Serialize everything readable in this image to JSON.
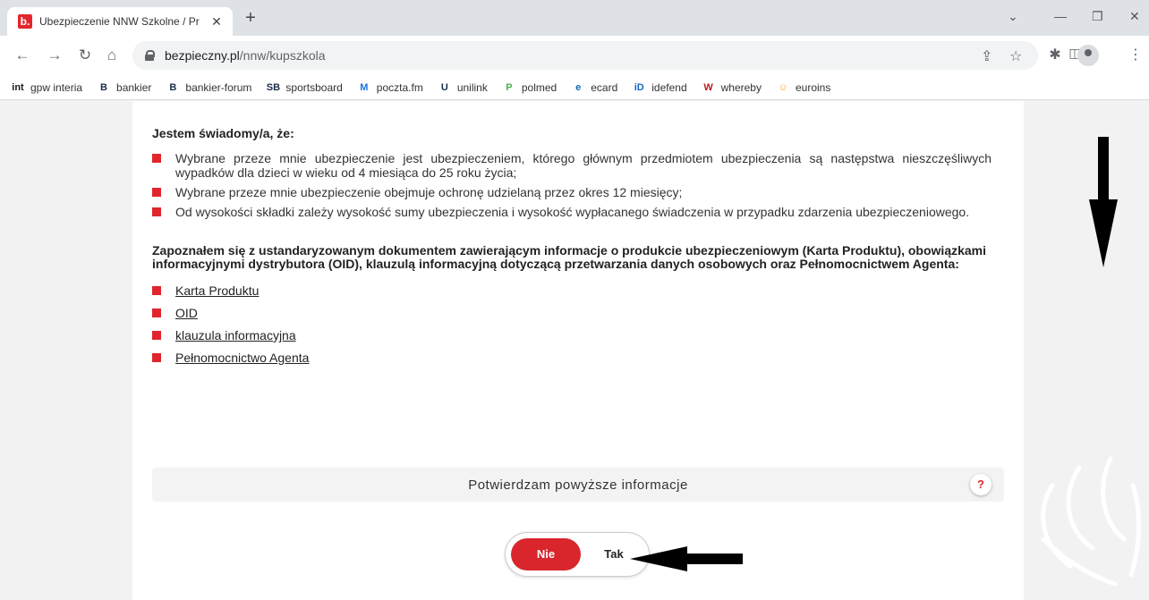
{
  "browser": {
    "tab_title": "Ubezpieczenie NNW Szkolne / Pr",
    "tab_favicon_letter": "b.",
    "new_tab_symbol": "+",
    "close_symbol": "✕",
    "url_host": "bezpieczny.pl",
    "url_path": "/nnw/kupszkola",
    "bookmarks": [
      {
        "label": "gpw interia",
        "icon": "int",
        "color": "#1a1a1a"
      },
      {
        "label": "bankier",
        "icon": "B",
        "color": "#1b2a4a"
      },
      {
        "label": "bankier-forum",
        "icon": "B",
        "color": "#1b2a4a"
      },
      {
        "label": "sportsboard",
        "icon": "SB",
        "color": "#1b2a4a"
      },
      {
        "label": "poczta.fm",
        "icon": "M",
        "color": "#1a73e8"
      },
      {
        "label": "unilink",
        "icon": "U",
        "color": "#1b2a4a"
      },
      {
        "label": "polmed",
        "icon": "P",
        "color": "#4caf50"
      },
      {
        "label": "ecard",
        "icon": "e",
        "color": "#1565c0"
      },
      {
        "label": "idefend",
        "icon": "iD",
        "color": "#1565c0"
      },
      {
        "label": "whereby",
        "icon": "W",
        "color": "#b71c1c"
      },
      {
        "label": "euroins",
        "icon": "☺",
        "color": "#f9a825"
      }
    ]
  },
  "page": {
    "heading": "Jestem świadomy/a, że:",
    "statements": [
      "Wybrane przeze mnie ubezpieczenie jest ubezpieczeniem, którego głównym przedmiotem ubezpieczenia są następstwa nieszczęśliwych wypadków dla dzieci w wieku od 4 miesiąca do 25 roku życia;",
      "Wybrane przeze mnie ubezpieczenie obejmuje ochronę udzielaną przez okres 12 miesięcy;",
      "Od wysokości składki zależy wysokość sumy ubezpieczenia i wysokość wypłacanego świadczenia w przypadku zdarzenia ubezpieczeniowego."
    ],
    "heading2": "Zapoznałem się z ustandaryzowanym dokumentem zawierającym informacje o produkcie ubezpieczeniowym (Karta Produktu), obowiązkami informacyjnymi dystrybutora (OID), klauzulą informacyjną dotyczącą przetwarzania danych osobowych oraz Pełnomocnictwem Agenta:",
    "documents": [
      "Karta Produktu",
      "OID",
      "klauzula informacyjna",
      "Pełnomocnictwo Agenta"
    ],
    "confirm_label": "Potwierdzam powyższe informacje",
    "help_label": "?",
    "toggle": {
      "no": "Nie",
      "yes": "Tak",
      "selected": "Nie"
    },
    "accent_color": "#e0262c"
  }
}
